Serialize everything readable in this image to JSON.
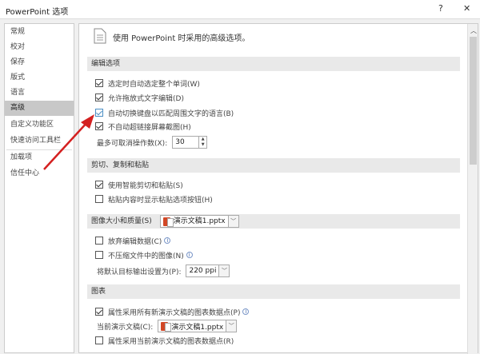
{
  "window": {
    "title": "PowerPoint 选项",
    "help": "?",
    "close": "✕"
  },
  "sidebar": {
    "items": [
      {
        "label": "常规"
      },
      {
        "label": "校对"
      },
      {
        "label": "保存"
      },
      {
        "label": "版式"
      },
      {
        "label": "语言"
      },
      {
        "label": "高级"
      },
      {
        "label": "自定义功能区"
      },
      {
        "label": "快速访问工具栏"
      },
      {
        "label": "加载项"
      },
      {
        "label": "信任中心"
      }
    ],
    "active": "高级"
  },
  "main": {
    "header": "使用 PowerPoint 时采用的高级选项。",
    "editing": {
      "title": "编辑选项",
      "items": [
        {
          "label": "选定时自动选定整个单词(W)",
          "checked": true
        },
        {
          "label": "允许拖放式文字编辑(D)",
          "checked": true
        },
        {
          "label": "自动切换键盘以匹配周围文字的语言(B)",
          "checked": true
        },
        {
          "label": "不自动超链接屏幕截图(H)",
          "checked": true
        }
      ],
      "undo_label": "最多可取消操作数(X):",
      "undo_value": "30"
    },
    "clipboard": {
      "title": "剪切、复制和粘贴",
      "items": [
        {
          "label": "使用智能剪切和粘贴(S)",
          "checked": true
        },
        {
          "label": "粘贴内容时显示粘贴选项按钮(H)",
          "checked": false
        }
      ]
    },
    "image": {
      "title": "图像大小和质量(S)",
      "file": "演示文稿1.pptx",
      "items": [
        {
          "label": "放弃编辑数据(C)",
          "checked": false
        },
        {
          "label": "不压缩文件中的图像(N)",
          "checked": false
        }
      ],
      "resolution_label": "将默认目标输出设置为(P):",
      "resolution_value": "220 ppi"
    },
    "chart": {
      "title": "图表",
      "items": [
        {
          "label": "属性采用所有新演示文稿的图表数据点(P)",
          "checked": true
        },
        {
          "label": "属性采用当前演示文稿的图表数据点(R)",
          "checked": false
        }
      ],
      "current_label": "当前演示文稿(C):",
      "current_file": "演示文稿1.pptx"
    }
  },
  "colors": {
    "arrow": "#d42020",
    "accent": "#4a8ec4"
  }
}
